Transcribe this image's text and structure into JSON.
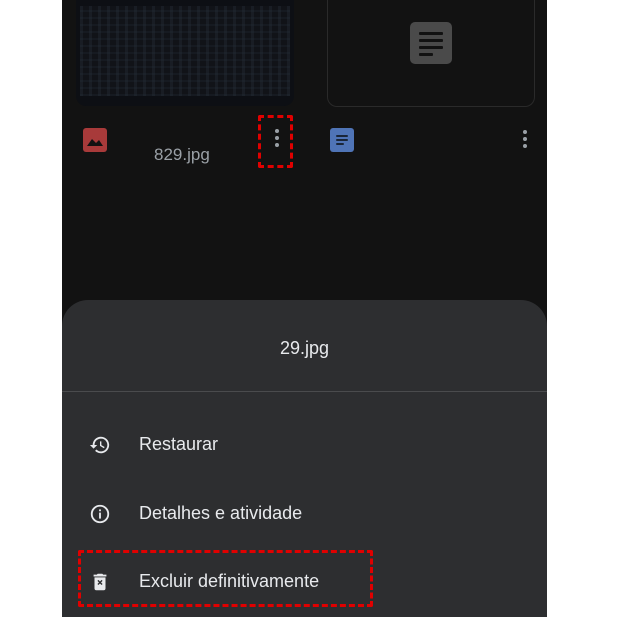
{
  "grid": {
    "files": [
      {
        "icon": "image-file-icon",
        "name": "829.jpg"
      },
      {
        "icon": "document-file-icon",
        "name": ""
      }
    ]
  },
  "sheet": {
    "title": "29.jpg",
    "items": [
      {
        "icon": "restore-history-icon",
        "label": "Restaurar"
      },
      {
        "icon": "info-icon",
        "label": "Detalhes e atividade"
      },
      {
        "icon": "delete-forever-icon",
        "label": "Excluir definitivamente"
      }
    ]
  },
  "colors": {
    "background": "#121212",
    "sheet": "#2d2e30",
    "text": "#e8eaed",
    "muted": "#9aa0a6",
    "image_icon": "#a83a3a",
    "doc_icon": "#4f74b6",
    "annotation": "#e00000"
  }
}
